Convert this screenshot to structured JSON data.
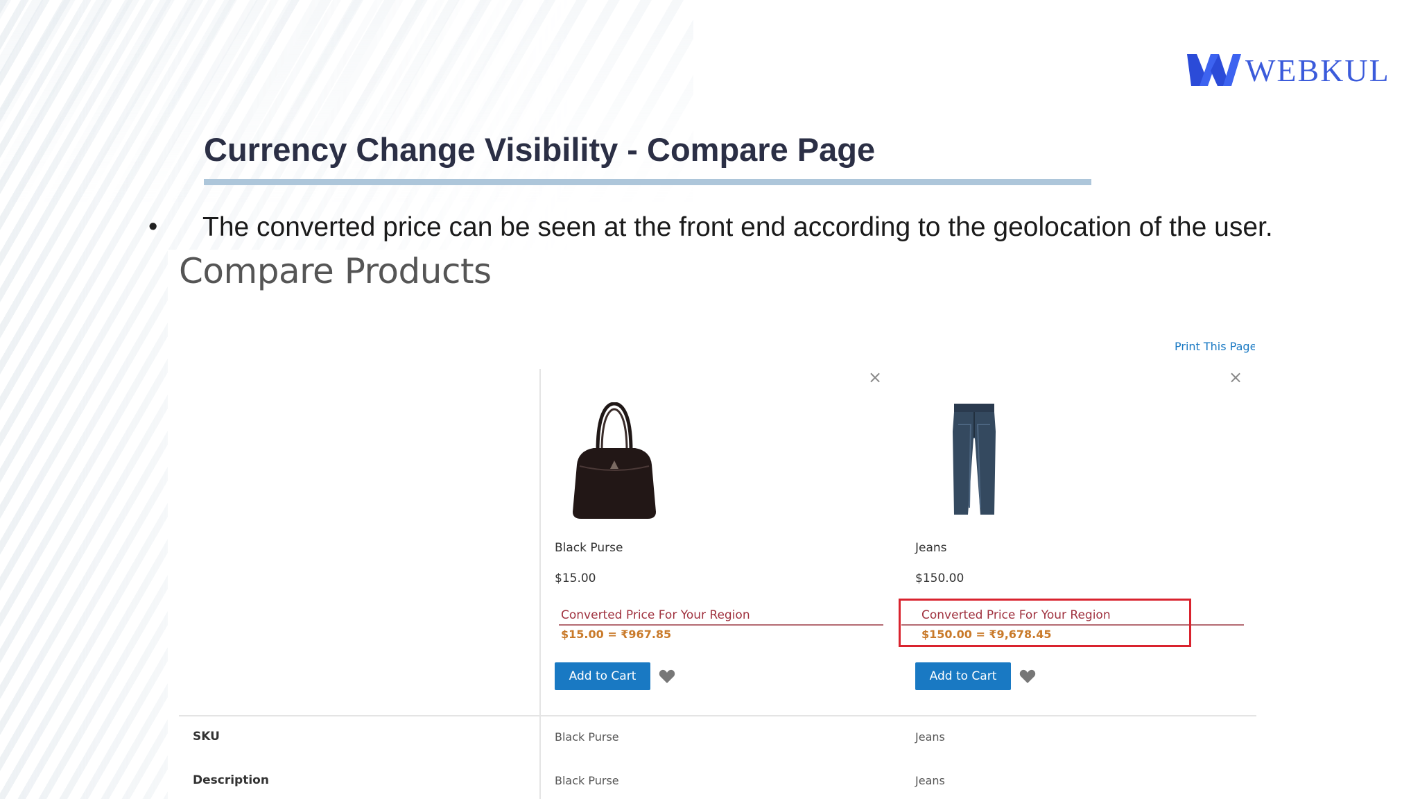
{
  "logo": {
    "text": "WEBKUL",
    "brand_color": "#3b5bdb"
  },
  "slide": {
    "title": "Currency Change Visibility - Compare Page",
    "bullet": "•",
    "bullet_text": "The converted price can be seen at the front end according to the geolocation of the user."
  },
  "compare": {
    "title": "Compare Products",
    "print_link": "Print This Page",
    "products": [
      {
        "name": "Black Purse",
        "price": "$15.00",
        "converted_label": "Converted Price For Your Region",
        "converted_value": "$15.00 = ₹967.85",
        "add_to_cart": "Add to Cart",
        "remove_icon": "×",
        "image_icon": "purse-image"
      },
      {
        "name": "Jeans",
        "price": "$150.00",
        "converted_label": "Converted Price For Your Region",
        "converted_value": "$150.00 = ₹9,678.45",
        "add_to_cart": "Add to Cart",
        "remove_icon": "×",
        "image_icon": "jeans-image"
      }
    ],
    "attributes": [
      {
        "label": "SKU",
        "values": [
          "Black Purse",
          "Jeans"
        ]
      },
      {
        "label": "Description",
        "values": [
          "Black Purse",
          "Jeans"
        ]
      }
    ],
    "colors": {
      "button": "#1979c3",
      "highlight": "#d9232e",
      "converted_label": "#a0323f",
      "converted_value": "#c97a2a"
    }
  }
}
